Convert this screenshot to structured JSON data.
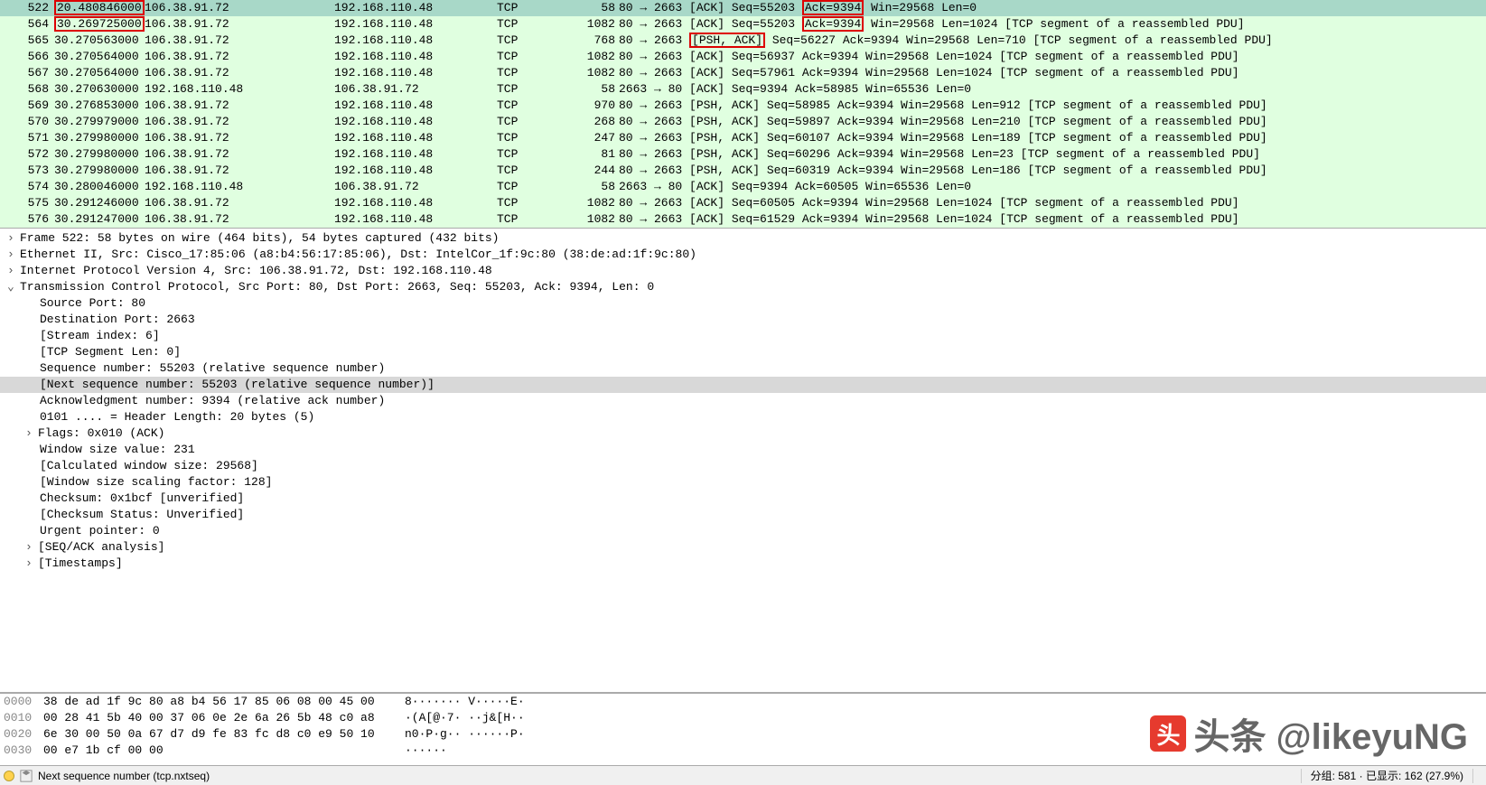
{
  "packets": [
    {
      "no": "522",
      "time": "20.480846000",
      "src": "106.38.91.72",
      "dst": "192.168.110.48",
      "proto": "TCP",
      "len": "58",
      "info_pre": "80 → 2663 [ACK] Seq=55203 ",
      "info_mid": "Ack=9394",
      "info_post": " Win=29568 Len=0",
      "selected": true,
      "box_time": true,
      "box_mid": true,
      "box_flags": false,
      "flags": ""
    },
    {
      "no": "564",
      "time": "30.269725000",
      "src": "106.38.91.72",
      "dst": "192.168.110.48",
      "proto": "TCP",
      "len": "1082",
      "info_pre": "80 → 2663 [ACK] Seq=55203 ",
      "info_mid": "Ack=9394",
      "info_post": " Win=29568 Len=1024 [TCP segment of a reassembled PDU]",
      "box_time": true,
      "box_mid": true,
      "box_flags": false,
      "flags": ""
    },
    {
      "no": "565",
      "time": "30.270563000",
      "src": "106.38.91.72",
      "dst": "192.168.110.48",
      "proto": "TCP",
      "len": "768",
      "info_pre": "80 → 2663 ",
      "flags": "[PSH, ACK]",
      "info_mid": "",
      "info_post": " Seq=56227 Ack=9394 Win=29568 Len=710 [TCP segment of a reassembled PDU]",
      "box_time": false,
      "box_flags": true,
      "box_mid": false
    },
    {
      "no": "566",
      "time": "30.270564000",
      "src": "106.38.91.72",
      "dst": "192.168.110.48",
      "proto": "TCP",
      "len": "1082",
      "info_pre": "80 → 2663 [ACK] Seq=56937 Ack=9394 Win=29568 Len=1024 [TCP segment of a reassembled PDU]",
      "flags": "",
      "info_mid": "",
      "info_post": ""
    },
    {
      "no": "567",
      "time": "30.270564000",
      "src": "106.38.91.72",
      "dst": "192.168.110.48",
      "proto": "TCP",
      "len": "1082",
      "info_pre": "80 → 2663 [ACK] Seq=57961 Ack=9394 Win=29568 Len=1024 [TCP segment of a reassembled PDU]",
      "flags": "",
      "info_mid": "",
      "info_post": ""
    },
    {
      "no": "568",
      "time": "30.270630000",
      "src": "192.168.110.48",
      "dst": "106.38.91.72",
      "proto": "TCP",
      "len": "58",
      "info_pre": "2663 → 80 [ACK] Seq=9394 Ack=58985 Win=65536 Len=0",
      "flags": "",
      "info_mid": "",
      "info_post": ""
    },
    {
      "no": "569",
      "time": "30.276853000",
      "src": "106.38.91.72",
      "dst": "192.168.110.48",
      "proto": "TCP",
      "len": "970",
      "info_pre": "80 → 2663 [PSH, ACK] Seq=58985 Ack=9394 Win=29568 Len=912 [TCP segment of a reassembled PDU]",
      "flags": "",
      "info_mid": "",
      "info_post": ""
    },
    {
      "no": "570",
      "time": "30.279979000",
      "src": "106.38.91.72",
      "dst": "192.168.110.48",
      "proto": "TCP",
      "len": "268",
      "info_pre": "80 → 2663 [PSH, ACK] Seq=59897 Ack=9394 Win=29568 Len=210 [TCP segment of a reassembled PDU]",
      "flags": "",
      "info_mid": "",
      "info_post": ""
    },
    {
      "no": "571",
      "time": "30.279980000",
      "src": "106.38.91.72",
      "dst": "192.168.110.48",
      "proto": "TCP",
      "len": "247",
      "info_pre": "80 → 2663 [PSH, ACK] Seq=60107 Ack=9394 Win=29568 Len=189 [TCP segment of a reassembled PDU]",
      "flags": "",
      "info_mid": "",
      "info_post": ""
    },
    {
      "no": "572",
      "time": "30.279980000",
      "src": "106.38.91.72",
      "dst": "192.168.110.48",
      "proto": "TCP",
      "len": "81",
      "info_pre": "80 → 2663 [PSH, ACK] Seq=60296 Ack=9394 Win=29568 Len=23 [TCP segment of a reassembled PDU]",
      "flags": "",
      "info_mid": "",
      "info_post": ""
    },
    {
      "no": "573",
      "time": "30.279980000",
      "src": "106.38.91.72",
      "dst": "192.168.110.48",
      "proto": "TCP",
      "len": "244",
      "info_pre": "80 → 2663 [PSH, ACK] Seq=60319 Ack=9394 Win=29568 Len=186 [TCP segment of a reassembled PDU]",
      "flags": "",
      "info_mid": "",
      "info_post": ""
    },
    {
      "no": "574",
      "time": "30.280046000",
      "src": "192.168.110.48",
      "dst": "106.38.91.72",
      "proto": "TCP",
      "len": "58",
      "info_pre": "2663 → 80 [ACK] Seq=9394 Ack=60505 Win=65536 Len=0",
      "flags": "",
      "info_mid": "",
      "info_post": ""
    },
    {
      "no": "575",
      "time": "30.291246000",
      "src": "106.38.91.72",
      "dst": "192.168.110.48",
      "proto": "TCP",
      "len": "1082",
      "info_pre": "80 → 2663 [ACK] Seq=60505 Ack=9394 Win=29568 Len=1024 [TCP segment of a reassembled PDU]",
      "flags": "",
      "info_mid": "",
      "info_post": ""
    },
    {
      "no": "576",
      "time": "30.291247000",
      "src": "106.38.91.72",
      "dst": "192.168.110.48",
      "proto": "TCP",
      "len": "1082",
      "info_pre": "80 → 2663 [ACK] Seq=61529 Ack=9394 Win=29568 Len=1024 [TCP segment of a reassembled PDU]",
      "flags": "",
      "info_mid": "",
      "info_post": ""
    }
  ],
  "detail": {
    "frame": "Frame 522: 58 bytes on wire (464 bits), 54 bytes captured (432 bits)",
    "eth": "Ethernet II, Src: Cisco_17:85:06 (a8:b4:56:17:85:06), Dst: IntelCor_1f:9c:80 (38:de:ad:1f:9c:80)",
    "ip": "Internet Protocol Version 4, Src: 106.38.91.72, Dst: 192.168.110.48",
    "tcp": "Transmission Control Protocol, Src Port: 80, Dst Port: 2663, Seq: 55203, Ack: 9394, Len: 0",
    "srcport": "Source Port: 80",
    "dstport": "Destination Port: 2663",
    "stream": "[Stream index: 6]",
    "seglen": "[TCP Segment Len: 0]",
    "seq": "Sequence number: 55203    (relative sequence number)",
    "nextseq": "[Next sequence number: 55203    (relative sequence number)]",
    "ack": "Acknowledgment number: 9394    (relative ack number)",
    "hdrlen": "0101 .... = Header Length: 20 bytes (5)",
    "flags": "Flags: 0x010 (ACK)",
    "win": "Window size value: 231",
    "calcwin": "[Calculated window size: 29568]",
    "winscale": "[Window size scaling factor: 128]",
    "cksum": "Checksum: 0x1bcf [unverified]",
    "cksumstat": "[Checksum Status: Unverified]",
    "urg": "Urgent pointer: 0",
    "seqack": "[SEQ/ACK analysis]",
    "ts": "[Timestamps]"
  },
  "hex": [
    {
      "off": "0000",
      "bytes": "38 de ad 1f 9c 80 a8 b4  56 17 85 06 08 00 45 00",
      "ascii": "8······· V·····E·"
    },
    {
      "off": "0010",
      "bytes": "00 28 41 5b 40 00 37 06  0e 2e 6a 26 5b 48 c0 a8",
      "ascii": "·(A[@·7· ··j&[H··"
    },
    {
      "off": "0020",
      "bytes": "6e 30 00 50 0a 67 d7 d9  fe 83 fc d8 c0 e9 50 10",
      "ascii": "n0·P·g·· ······P·"
    },
    {
      "off": "0030",
      "bytes": "00 e7 1b cf 00 00",
      "ascii": "······"
    }
  ],
  "status": {
    "left": "Next sequence number (tcp.nxtseq)",
    "right": "分组: 581 · 已显示: 162 (27.9%)"
  },
  "watermark": "头条 @likeyuNG"
}
